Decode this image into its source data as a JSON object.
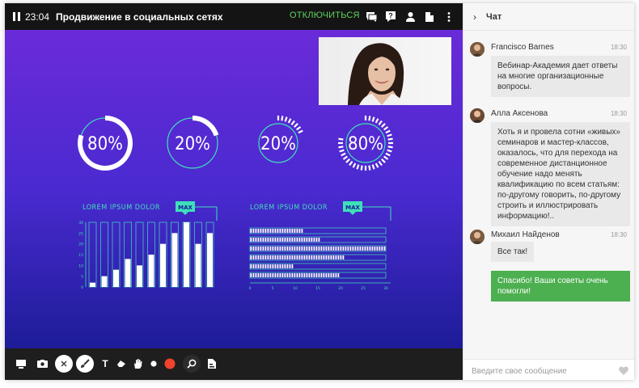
{
  "session": {
    "time": "23:04",
    "title": "Продвижение в социальных сетях",
    "disconnect_label": "ОТКЛЮЧИТЬСЯ"
  },
  "topbar_icons": [
    "chat-icon",
    "question-icon",
    "user-icon",
    "document-icon",
    "more-vertical-icon"
  ],
  "slide": {
    "rings": [
      {
        "label": "80%",
        "value": 80,
        "style": "solid"
      },
      {
        "label": "20%",
        "value": 20,
        "style": "solid"
      },
      {
        "label": "20%",
        "value": 20,
        "style": "dashed"
      },
      {
        "label": "80%",
        "value": 80,
        "style": "dashed"
      }
    ],
    "bar_panel": {
      "title": "LOREM IPSUM DOLOR",
      "badge": "MAX"
    },
    "hbar_panel": {
      "title": "LOREM IPSUM DOLOR",
      "badge": "MAX"
    },
    "colors": {
      "accent": "#3ee0b8",
      "bar": "#ffffff"
    }
  },
  "chart_data": [
    {
      "type": "bar",
      "title": "LOREM IPSUM DOLOR",
      "yticks": [
        "0",
        "5",
        "10",
        "15",
        "20",
        "25",
        "30"
      ],
      "ylim": [
        0,
        30
      ],
      "values": [
        2,
        5,
        8,
        13,
        10,
        15,
        20,
        25,
        30,
        20,
        25
      ]
    },
    {
      "type": "bar",
      "orientation": "horizontal",
      "title": "LOREM IPSUM DOLOR",
      "xticks": [
        "0",
        "5",
        "10",
        "15",
        "20",
        "25",
        "30"
      ],
      "xlim": [
        0,
        30
      ],
      "values": [
        12,
        16,
        30,
        21,
        10,
        20
      ]
    }
  ],
  "toolbar": {
    "icons": [
      "screen-share-icon",
      "camera-switch-icon",
      "close-icon",
      "brush-icon",
      "text-icon",
      "eraser-icon",
      "hand-icon",
      "dot-icon",
      "record-icon",
      "zoom-icon",
      "file-icon"
    ],
    "text_label": "T"
  },
  "chat": {
    "title": "Чат",
    "messages": [
      {
        "name": "Francisco Barnes",
        "time": "18:30",
        "text": "Вебинар-Академия дает ответы на многие организационные вопросы."
      },
      {
        "name": "Алла Аксенова",
        "time": "18:30",
        "text": "Хоть я и провела сотни «живых» семинаров и мастер-классов, оказалось, что для перехода на современное дистанционное обучение надо менять квалификацию по всем статьям: по-другому говорить, по-другому строить и иллюстрировать информацию!.."
      },
      {
        "name": "Михаил Найденов",
        "time": "18:30",
        "text": "Все так!"
      }
    ],
    "my_message": "Спасибо! Ваши советы очень помогли!",
    "input_placeholder": "Введите свое сообщение",
    "colors": {
      "my_bubble": "#4caf50",
      "other_bubble": "#e9e9e9"
    }
  }
}
